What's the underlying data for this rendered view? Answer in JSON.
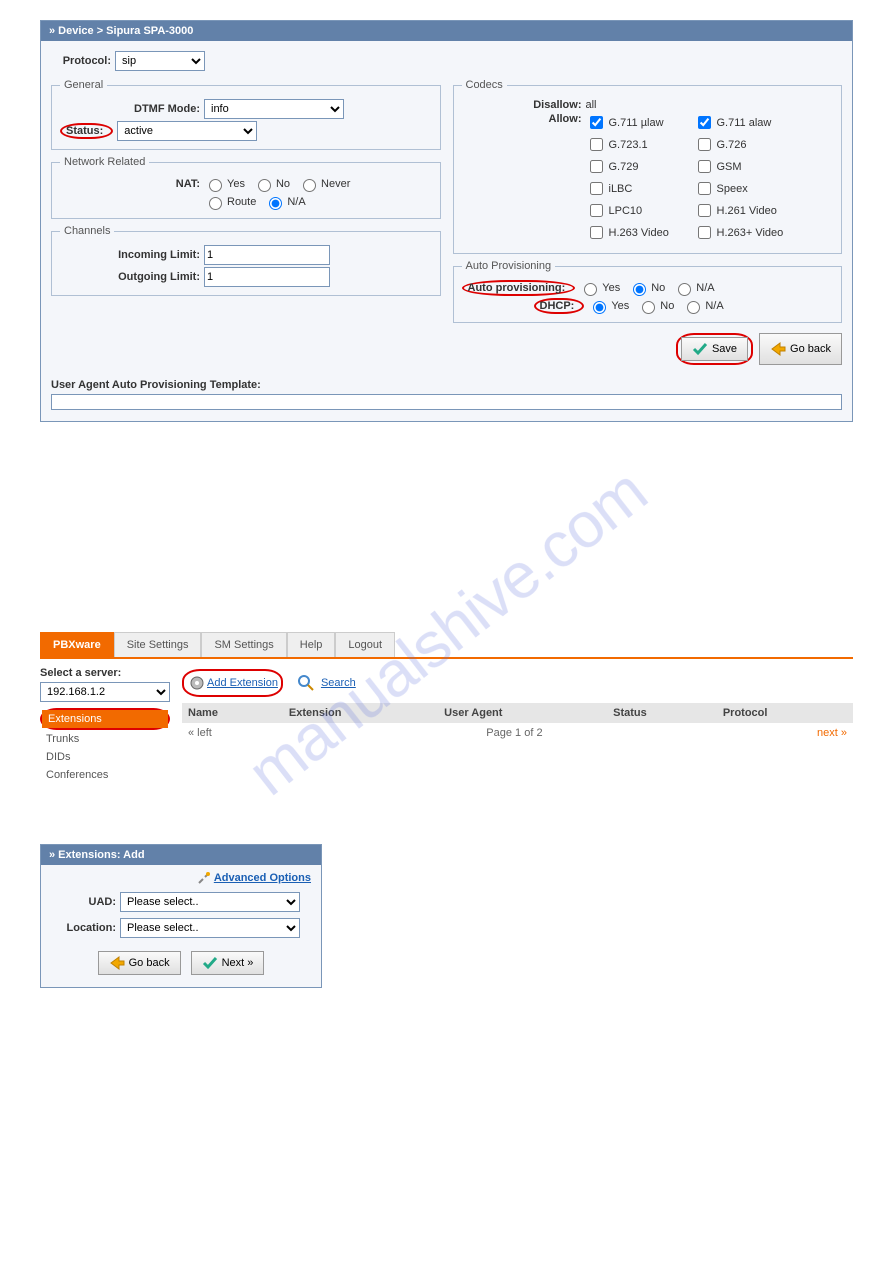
{
  "watermark": "manualshive.com",
  "device": {
    "breadcrumb": "» Device > Sipura SPA-3000",
    "protocol_label": "Protocol:",
    "protocol_value": "sip",
    "general": {
      "legend": "General",
      "dtmf_label": "DTMF Mode:",
      "dtmf_value": "info",
      "status_label": "Status:",
      "status_value": "active"
    },
    "network": {
      "legend": "Network Related",
      "nat_label": "NAT:",
      "opts": {
        "yes": "Yes",
        "no": "No",
        "never": "Never",
        "route": "Route",
        "na": "N/A"
      }
    },
    "channels": {
      "legend": "Channels",
      "in_label": "Incoming Limit:",
      "in_value": "1",
      "out_label": "Outgoing Limit:",
      "out_value": "1"
    },
    "codecs": {
      "legend": "Codecs",
      "disallow_label": "Disallow:",
      "disallow_value": "all",
      "allow_label": "Allow:",
      "items": {
        "g711u": "G.711 µlaw",
        "g711a": "G.711 alaw",
        "g7231": "G.723.1",
        "g726": "G.726",
        "g729": "G.729",
        "gsm": "GSM",
        "ilbc": "iLBC",
        "speex": "Speex",
        "lpc10": "LPC10",
        "h261": "H.261 Video",
        "h263": "H.263 Video",
        "h263p": "H.263+ Video"
      }
    },
    "autoprov": {
      "legend": "Auto Provisioning",
      "ap_label": "Auto provisioning:",
      "dhcp_label": "DHCP:",
      "yes": "Yes",
      "no": "No",
      "na": "N/A"
    },
    "save": "Save",
    "goback": "Go back",
    "uaapt_label": "User Agent Auto Provisioning Template:"
  },
  "pbx": {
    "tabs": {
      "pbxware": "PBXware",
      "site": "Site Settings",
      "sm": "SM Settings",
      "help": "Help",
      "logout": "Logout"
    },
    "server_label": "Select a server:",
    "server_value": "192.168.1.2",
    "nav": {
      "ext": "Extensions",
      "trunks": "Trunks",
      "dids": "DIDs",
      "conf": "Conferences"
    },
    "add_ext": "Add Extension",
    "search": "Search",
    "cols": {
      "name": "Name",
      "ext": "Extension",
      "ua": "User Agent",
      "status": "Status",
      "proto": "Protocol"
    },
    "pg": {
      "left": "« left",
      "page": "Page 1 of 2",
      "next": "next »"
    }
  },
  "extadd": {
    "title": "» Extensions: Add",
    "adv": "Advanced Options",
    "uad_label": "UAD:",
    "uad_value": "Please select..",
    "loc_label": "Location:",
    "loc_value": "Please select..",
    "goback": "Go back",
    "next": "Next »"
  }
}
